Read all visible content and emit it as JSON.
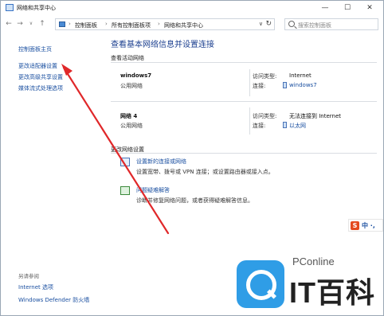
{
  "window": {
    "title": "网络和共享中心",
    "minimize": "—",
    "maximize": "☐",
    "close": "✕"
  },
  "nav": {
    "back": "←",
    "forward": "→",
    "up_dropdown": "∨",
    "up": "↑",
    "breadcrumb": [
      "控制面板",
      "所有控制面板项",
      "网络和共享中心"
    ],
    "separator": "›",
    "dropdown": "∨",
    "refresh": "↻",
    "search_placeholder": "搜索控制面板"
  },
  "sidebar": {
    "home": "控制面板主页",
    "links": [
      "更改适配器设置",
      "更改高级共享设置",
      "媒体流式处理选项"
    ],
    "see_also_heading": "另请参阅",
    "see_also": [
      "Internet 选项",
      "Windows Defender 防火墙"
    ]
  },
  "main": {
    "title": "查看基本网络信息并设置连接",
    "active_networks_label": "查看活动网络",
    "networks": [
      {
        "name": "windows7",
        "category": "公用网络",
        "access_type_label": "访问类型:",
        "access_type": "Internet",
        "connection_label": "连接:",
        "connection": "windows7"
      },
      {
        "name": "网络 4",
        "category": "公用网络",
        "access_type_label": "访问类型:",
        "access_type": "无法连接到 Internet",
        "connection_label": "连接:",
        "connection": "以太网"
      }
    ],
    "change_settings_label": "更改网络设置",
    "tasks": [
      {
        "link": "设置新的连接或网络",
        "desc": "设置宽带、拨号或 VPN 连接；或设置路由器或接入点。",
        "icon": "network-setup-icon"
      },
      {
        "link": "问题疑难解答",
        "desc": "诊断并修复网络问题，或者获得疑难解答信息。",
        "icon": "troubleshoot-icon"
      }
    ]
  },
  "ime": {
    "logo": "S",
    "text": "中 ·,"
  },
  "watermark": {
    "brand": "PConline",
    "big": "IT百科"
  },
  "colors": {
    "link": "#1a4fa0",
    "heading": "#1b3f8f",
    "arrow": "#e0282a",
    "watermark_blue": "#2f9de6"
  }
}
